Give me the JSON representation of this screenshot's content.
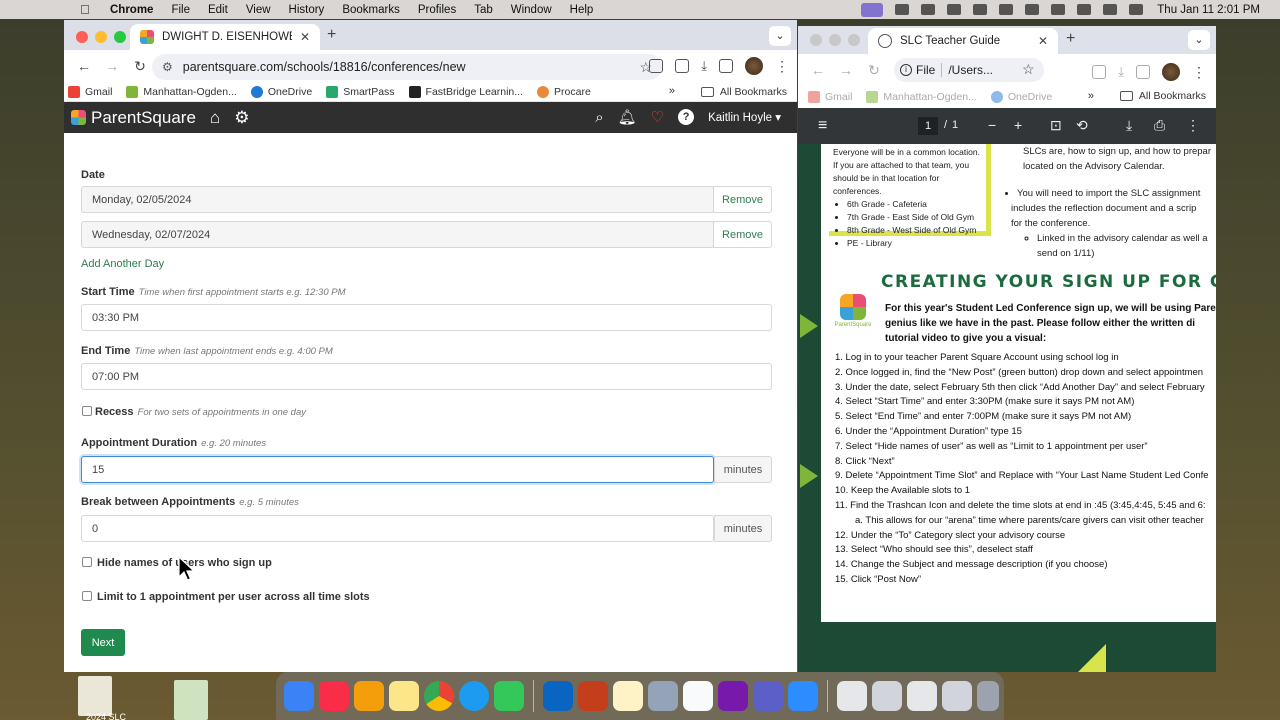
{
  "menubar": {
    "app": "Chrome",
    "items": [
      "File",
      "Edit",
      "View",
      "History",
      "Bookmarks",
      "Profiles",
      "Tab",
      "Window",
      "Help"
    ],
    "clock": "Thu Jan 11  2:01 PM"
  },
  "left_window": {
    "tab_title": "DWIGHT D. EISENHOWER MI",
    "url": "parentsquare.com/schools/18816/conferences/new",
    "bookmarks": [
      "Gmail",
      "Manhattan-Ogden...",
      "OneDrive",
      "SmartPass",
      "FastBridge Learnin...",
      "Procare"
    ],
    "bookmarks_more": "»",
    "all_bookmarks": "All Bookmarks"
  },
  "app": {
    "name": "ParentSquare",
    "user": "Kaitlin Hoyle"
  },
  "form": {
    "date_label": "Date",
    "dates": [
      "Monday, 02/05/2024",
      "Wednesday, 02/07/2024"
    ],
    "remove_label": "Remove",
    "add_day": "Add Another Day",
    "start_time": {
      "label": "Start Time",
      "hint": "Time when first appointment starts e.g. 12:30 PM",
      "value": "03:30 PM"
    },
    "end_time": {
      "label": "End Time",
      "hint": "Time when last appointment ends e.g. 4:00 PM",
      "value": "07:00 PM"
    },
    "recess": {
      "label": "Recess",
      "hint": "For two sets of appointments in one day"
    },
    "duration": {
      "label": "Appointment Duration",
      "hint": "e.g. 20 minutes",
      "value": "15",
      "unit": "minutes"
    },
    "break": {
      "label": "Break between Appointments",
      "hint": "e.g. 5 minutes",
      "value": "0",
      "unit": "minutes"
    },
    "hide_names": "Hide names of users who sign up",
    "limit": "Limit to 1 appointment per user across all time slots",
    "next": "Next"
  },
  "right_window": {
    "tab_title": "SLC Teacher Guide",
    "omni_file": "File",
    "omni_path": "/Users...",
    "bookmarks": [
      "Gmail",
      "Manhattan-Ogden...",
      "OneDrive"
    ],
    "bookmarks_more": "»",
    "all_bookmarks": "All Bookmarks",
    "pdf_page": "1",
    "pdf_sep": "/",
    "pdf_total": "1"
  },
  "pdf": {
    "box_text": "Everyone will be in a common location. If you are attached to that team, you should be in that location for conferences.",
    "box_items": [
      "6th Grade - Cafeteria",
      "7th Grade - East Side of Old Gym",
      "8th Grade - West Side of Old Gym",
      "PE - Library"
    ],
    "right_lines": [
      "SLCs are, how to sign up, and how to prepar",
      "located on the Advisory Calendar."
    ],
    "right_bullet": [
      "You will need to import the SLC assignment",
      "includes the reflection document and a scrip",
      "for the conference."
    ],
    "right_sub": [
      "Linked in the advisory calendar as well a",
      "send on 1/11)"
    ],
    "heading": "CREATING YOUR SIGN UP FOR CONF",
    "logo_caption": "ParentSquare",
    "intro": [
      "For this year's Student Led Conference sign up, we will be using Paren",
      "genius like we have in the past. Please follow either the written di",
      "tutorial video to give you a visual:"
    ],
    "steps": [
      "1.  Log in to your teacher Parent Square Account using school log in",
      "2.  Once logged in, find the “New Post” (green button) drop down and select appointmen",
      "3.  Under the date, select February 5th then click “Add Another Day” and select February",
      "4.  Select “Start Time” and enter 3:30PM (make sure it says PM not AM)",
      "5.  Select “End Time” and enter 7:00PM (make sure it says PM not AM)",
      "6.  Under the “Appointment Duration” type 15",
      "7.  Select “Hide names of user” as well as “Limit to 1 appointment per user”",
      "8.  Click “Next”",
      "9.  Delete “Appointment Time Slot” and Replace with “Your Last Name Student Led Confe",
      "10. Keep the Available slots to 1",
      "11. Find the Trashcan Icon and delete the time slots at end in :45 (3:45,4:45, 5:45 and 6:",
      "a. This allows for our “arena” time where parents/care givers can visit other teacher",
      "12. Under the “To” Category slect your advisory course",
      "13. Select “Who should see this”, deselect staff",
      "14. Change the Subject and message description (if you choose)",
      "15. Click “Post Now”"
    ]
  },
  "desktop": {
    "file_label": "2024 SLC"
  }
}
